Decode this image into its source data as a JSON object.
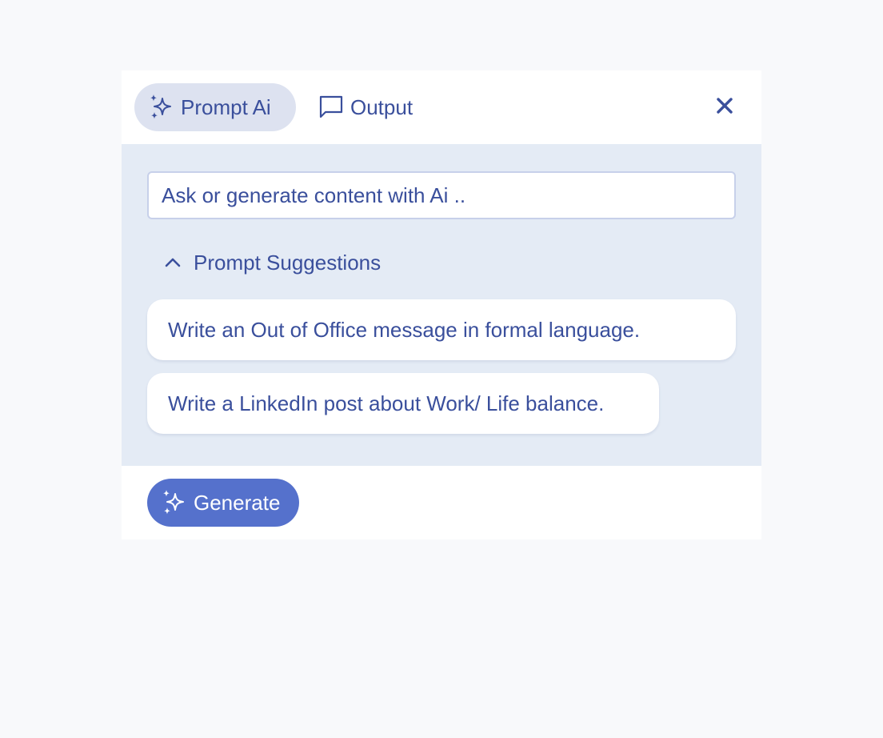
{
  "colors": {
    "accent": "#3a4f9c",
    "tab_active_bg": "#dde2f0",
    "content_bg": "#e4ebf5",
    "primary_button": "#5571cc",
    "page_bg": "#f8f9fb"
  },
  "tabs": [
    {
      "label": "Prompt Ai",
      "icon": "sparkles-icon",
      "active": true
    },
    {
      "label": "Output",
      "icon": "chat-bubble-icon",
      "active": false
    }
  ],
  "header": {
    "close_icon": "close-icon"
  },
  "prompt": {
    "placeholder": "Ask or generate content with Ai ..",
    "value": ""
  },
  "suggestions": {
    "toggle_label": "Prompt Suggestions",
    "toggle_icon": "chevron-up-icon",
    "expanded": true,
    "items": [
      {
        "text": "Write an Out of Office message in formal language."
      },
      {
        "text": "Write a LinkedIn post about Work/ Life balance."
      }
    ]
  },
  "footer": {
    "generate_label": "Generate",
    "generate_icon": "sparkles-icon"
  }
}
